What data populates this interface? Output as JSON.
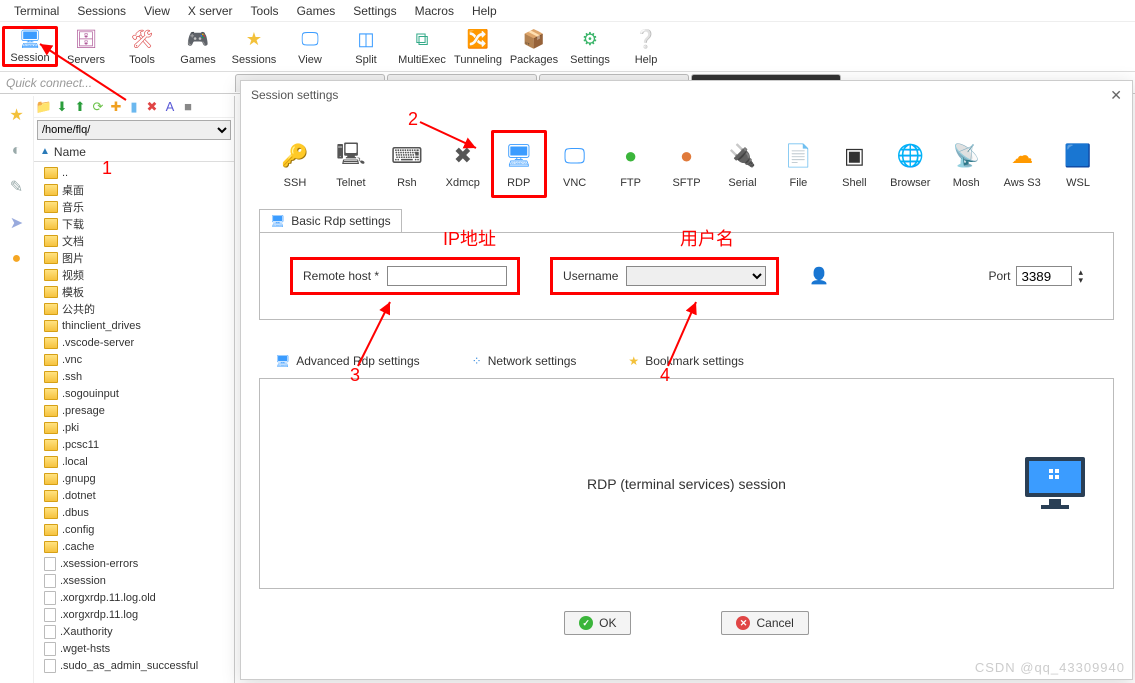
{
  "menu": [
    "Terminal",
    "Sessions",
    "View",
    "X server",
    "Tools",
    "Games",
    "Settings",
    "Macros",
    "Help"
  ],
  "toolbar": [
    {
      "label": "Session",
      "icon": "monitor",
      "highlight": true
    },
    {
      "label": "Servers",
      "icon": "servers"
    },
    {
      "label": "Tools",
      "icon": "tools"
    },
    {
      "label": "Games",
      "icon": "games"
    },
    {
      "label": "Sessions",
      "icon": "sessions"
    },
    {
      "label": "View",
      "icon": "view"
    },
    {
      "label": "Split",
      "icon": "split"
    },
    {
      "label": "MultiExec",
      "icon": "multiexec"
    },
    {
      "label": "Tunneling",
      "icon": "tunneling"
    },
    {
      "label": "Packages",
      "icon": "packages"
    },
    {
      "label": "Settings",
      "icon": "settings"
    },
    {
      "label": "Help",
      "icon": "help"
    }
  ],
  "quick_connect_placeholder": "Quick connect...",
  "sidebar": {
    "path": "/home/flq/",
    "header": "Name",
    "up": "..",
    "items": [
      {
        "name": "桌面",
        "type": "folder"
      },
      {
        "name": "音乐",
        "type": "folder"
      },
      {
        "name": "下载",
        "type": "folder"
      },
      {
        "name": "文档",
        "type": "folder"
      },
      {
        "name": "图片",
        "type": "folder"
      },
      {
        "name": "视频",
        "type": "folder"
      },
      {
        "name": "模板",
        "type": "folder"
      },
      {
        "name": "公共的",
        "type": "folder"
      },
      {
        "name": "thinclient_drives",
        "type": "folder"
      },
      {
        "name": ".vscode-server",
        "type": "folder"
      },
      {
        "name": ".vnc",
        "type": "folder"
      },
      {
        "name": ".ssh",
        "type": "folder"
      },
      {
        "name": ".sogouinput",
        "type": "folder"
      },
      {
        "name": ".presage",
        "type": "folder"
      },
      {
        "name": ".pki",
        "type": "folder"
      },
      {
        "name": ".pcsc11",
        "type": "folder"
      },
      {
        "name": ".local",
        "type": "folder"
      },
      {
        "name": ".gnupg",
        "type": "folder"
      },
      {
        "name": ".dotnet",
        "type": "folder"
      },
      {
        "name": ".dbus",
        "type": "folder"
      },
      {
        "name": ".config",
        "type": "folder"
      },
      {
        "name": ".cache",
        "type": "folder"
      },
      {
        "name": ".xsession-errors",
        "type": "file"
      },
      {
        "name": ".xsession",
        "type": "file"
      },
      {
        "name": ".xorgxrdp.11.log.old",
        "type": "file"
      },
      {
        "name": ".xorgxrdp.11.log",
        "type": "file"
      },
      {
        "name": ".Xauthority",
        "type": "file"
      },
      {
        "name": ".wget-hsts",
        "type": "file"
      },
      {
        "name": ".sudo_as_admin_successful",
        "type": "file"
      }
    ]
  },
  "dialog": {
    "title": "Session settings",
    "types": [
      "SSH",
      "Telnet",
      "Rsh",
      "Xdmcp",
      "RDP",
      "VNC",
      "FTP",
      "SFTP",
      "Serial",
      "File",
      "Shell",
      "Browser",
      "Mosh",
      "Aws S3",
      "WSL"
    ],
    "selected_type": "RDP",
    "basic_tab_label": "Basic Rdp settings",
    "remote_host_label": "Remote host *",
    "remote_host_value": "",
    "username_label": "Username",
    "username_value": "",
    "port_label": "Port",
    "port_value": "3389",
    "sub_tabs": [
      "Advanced Rdp settings",
      "Network settings",
      "Bookmark settings"
    ],
    "session_desc": "RDP (terminal services) session",
    "ok_label": "OK",
    "cancel_label": "Cancel"
  },
  "annotations": {
    "n1": "1",
    "n2": "2",
    "n3": "3",
    "n4": "4",
    "ip_label": "IP地址",
    "user_label": "用户名"
  },
  "watermark": "CSDN @qq_43309940"
}
